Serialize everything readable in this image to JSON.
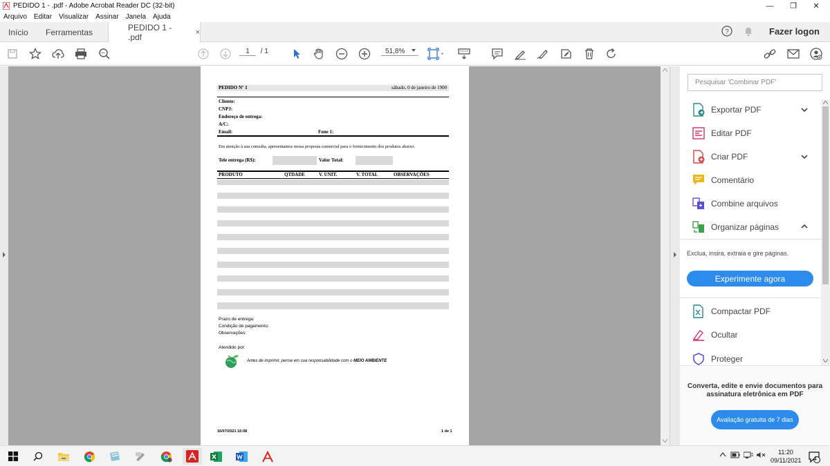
{
  "window": {
    "title": "PEDIDO  1 - .pdf - Adobe Acrobat Reader DC (32-bit)",
    "minimize": "—",
    "maximize": "❐",
    "close": "✕"
  },
  "menu": [
    "Arquivo",
    "Editar",
    "Visualizar",
    "Assinar",
    "Janela",
    "Ajuda"
  ],
  "tabs": {
    "home": "Início",
    "tools": "Ferramentas",
    "document": "PEDIDO  1 - .pdf",
    "close": "×"
  },
  "header": {
    "login": "Fazer logon"
  },
  "toolbar": {
    "page_current": "1",
    "page_total": "/ 1",
    "zoom": "51,8%"
  },
  "document": {
    "order_title": "PEDIDO Nº 1",
    "date": "sábado, 0 de janeiro de 1900",
    "client_label": "Cliente:",
    "cnpj_label": "CNPJ:",
    "address_label": "Endereço de entrega:",
    "ac_label": "A/C:",
    "email_label": "Email:",
    "phone_label": "Fone 1:",
    "intro": "Em atenção à sua consulta, apresentamos nossa proposta comercial para o fornecimento dos produtos abaixo.",
    "delivery_fee_label": "Tele entrega (R$):",
    "total_label": "Valor Total:",
    "columns": [
      "PRODUTO",
      "QTDADE",
      "V. UNIT.",
      "V. TOTAL",
      "OBSERVAÇÕES"
    ],
    "deadline_label": "Prazo de entrega:",
    "payment_label": "Condição de pagamento:",
    "notes_label": "Observações:",
    "attended_label": "Atendido por:",
    "eco_text": "Antes de imprimir, pense em sua responsabilidade com o",
    "eco_bold": "MEIO AMBIENTE",
    "footer_date": "16/07/2021  16:08",
    "footer_page": "1 de 1"
  },
  "right_panel": {
    "search_placeholder": "Pesquisar 'Combinar PDF'",
    "items": [
      {
        "label": "Exportar PDF",
        "icon": "export-pdf-icon",
        "color": "#2a8a8a"
      },
      {
        "label": "Editar PDF",
        "icon": "edit-pdf-icon",
        "color": "#d6306b"
      },
      {
        "label": "Criar PDF",
        "icon": "create-pdf-icon",
        "color": "#d64545"
      },
      {
        "label": "Comentário",
        "icon": "comment-icon",
        "color": "#e8b81a"
      },
      {
        "label": "Combine arquivos",
        "icon": "combine-icon",
        "color": "#5a4fcf"
      },
      {
        "label": "Organizar páginas",
        "icon": "organize-icon",
        "color": "#3aa548"
      },
      {
        "label": "Compactar PDF",
        "icon": "compress-icon",
        "color": "#2a8a8a"
      },
      {
        "label": "Ocultar",
        "icon": "redact-icon",
        "color": "#d6306b"
      },
      {
        "label": "Proteger",
        "icon": "protect-icon",
        "color": "#5a4fcf"
      }
    ],
    "organize_desc": "Exclua, insira, extraia e gire páginas.",
    "try_button": "Experimente agora",
    "promo_text": "Converta, edite e envie documentos para assinatura eletrônica em PDF",
    "promo_button": "Avaliação gratuita de 7 dias"
  },
  "taskbar": {
    "time": "11:20",
    "date": "09/11/2021",
    "notification_count": "4"
  }
}
